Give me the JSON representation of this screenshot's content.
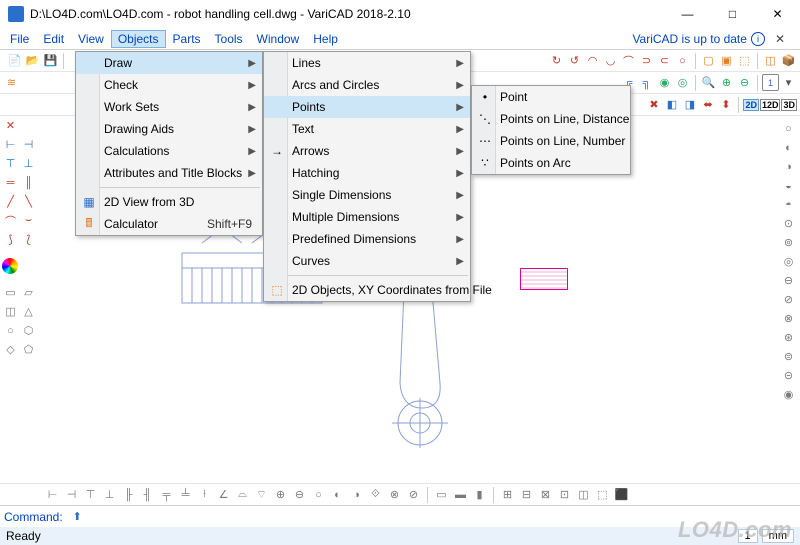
{
  "title": "D:\\LO4D.com\\LO4D.com - robot handling cell.dwg - VariCAD 2018-2.10",
  "menubar": {
    "items": [
      "File",
      "Edit",
      "View",
      "Objects",
      "Parts",
      "Tools",
      "Window",
      "Help"
    ],
    "status": "VariCAD is up to date"
  },
  "menu1": {
    "items": [
      {
        "label": "Draw",
        "arrow": true,
        "highlight": true
      },
      {
        "label": "Check",
        "arrow": true
      },
      {
        "label": "Work Sets",
        "arrow": true
      },
      {
        "label": "Drawing Aids",
        "arrow": true
      },
      {
        "label": "Calculations",
        "arrow": true
      },
      {
        "label": "Attributes and Title Blocks",
        "arrow": true
      }
    ],
    "items2": [
      {
        "label": "2D View from 3D",
        "icon": "view2d"
      },
      {
        "label": "Calculator",
        "shortcut": "Shift+F9",
        "icon": "calc"
      }
    ]
  },
  "menu2": {
    "items": [
      {
        "label": "Lines",
        "arrow": true
      },
      {
        "label": "Arcs and Circles",
        "arrow": true
      },
      {
        "label": "Points",
        "arrow": true,
        "highlight": true
      },
      {
        "label": "Text",
        "arrow": true
      },
      {
        "label": "Arrows",
        "arrow": true,
        "icon": "arrow"
      },
      {
        "label": "Hatching",
        "arrow": true
      },
      {
        "label": "Single Dimensions",
        "arrow": true
      },
      {
        "label": "Multiple Dimensions",
        "arrow": true
      },
      {
        "label": "Predefined Dimensions",
        "arrow": true
      },
      {
        "label": "Curves",
        "arrow": true
      }
    ],
    "items2": [
      {
        "label": "2D Objects, XY Coordinates from File",
        "icon": "import"
      }
    ]
  },
  "menu3": {
    "items": [
      {
        "label": "Point",
        "icon": "pt"
      },
      {
        "label": "Points on Line, Distance",
        "icon": "ptd"
      },
      {
        "label": "Points on Line, Number",
        "icon": "ptn"
      },
      {
        "label": "Points on Arc",
        "icon": "pta"
      }
    ]
  },
  "command": {
    "label": "Command:"
  },
  "status": {
    "ready": "Ready",
    "unit": "mm",
    "scale": "1"
  },
  "dim_labels": {
    "d2": "2D",
    "d12": "12D",
    "d3": "3D"
  },
  "watermark": "LO4D.com"
}
